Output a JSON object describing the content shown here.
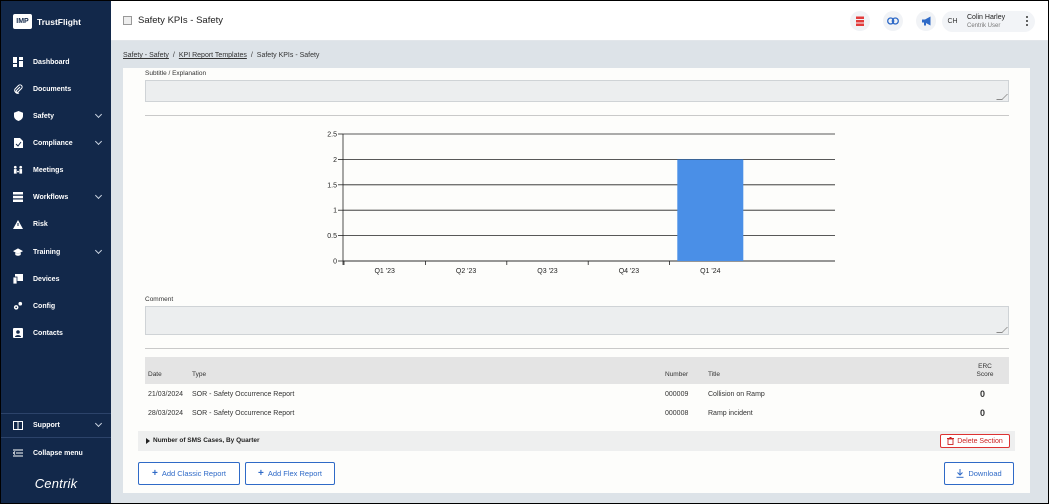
{
  "brand": {
    "logo_text": "IMP",
    "name": "TrustFlight"
  },
  "sidebar": {
    "items": [
      {
        "label": "Dashboard",
        "icon": "dashboard-icon",
        "has_chevron": false
      },
      {
        "label": "Documents",
        "icon": "paperclip-icon",
        "has_chevron": false
      },
      {
        "label": "Safety",
        "icon": "shield-icon",
        "has_chevron": true
      },
      {
        "label": "Compliance",
        "icon": "document-check-icon",
        "has_chevron": true
      },
      {
        "label": "Meetings",
        "icon": "meetings-icon",
        "has_chevron": false
      },
      {
        "label": "Workflows",
        "icon": "workflow-icon",
        "has_chevron": true
      },
      {
        "label": "Risk",
        "icon": "warning-icon",
        "has_chevron": false
      },
      {
        "label": "Training",
        "icon": "graduation-cap-icon",
        "has_chevron": true
      },
      {
        "label": "Devices",
        "icon": "devices-icon",
        "has_chevron": false
      },
      {
        "label": "Config",
        "icon": "config-icon",
        "has_chevron": false
      },
      {
        "label": "Contacts",
        "icon": "contacts-icon",
        "has_chevron": false
      }
    ],
    "support_label": "Support",
    "collapse_label": "Collapse menu",
    "footer_logo": "Centrik"
  },
  "header": {
    "title": "Safety KPIs - Safety",
    "user": {
      "initials": "CH",
      "name": "Colin Harley",
      "role": "Centrik User"
    }
  },
  "breadcrumb": [
    "Safety - Safety",
    "KPI Report Templates",
    "Safety KPIs - Safety"
  ],
  "form": {
    "subtitle_label": "Subtitle / Explanation",
    "subtitle_value": "",
    "comment_label": "Comment",
    "comment_value": ""
  },
  "chart_data": {
    "type": "bar",
    "categories": [
      "Q1 '23",
      "Q2 '23",
      "Q3 '23",
      "Q4 '23",
      "Q1 '24"
    ],
    "values": [
      0,
      0,
      0,
      0,
      2
    ],
    "y_ticks": [
      "0",
      "0.5",
      "1",
      "1.5",
      "2",
      "2.5"
    ],
    "ylim": [
      0,
      2.5
    ],
    "grid": true,
    "bar_color": "#4a8fe7"
  },
  "table": {
    "headers": {
      "date": "Date",
      "type": "Type",
      "number": "Number",
      "title": "Title",
      "erc": "ERC Score"
    },
    "rows": [
      {
        "date": "21/03/2024",
        "type": "SOR - Safety Occurrence Report",
        "number": "000009",
        "title": "Collision on Ramp",
        "erc": "0"
      },
      {
        "date": "28/03/2024",
        "type": "SOR - Safety Occurrence Report",
        "number": "000008",
        "title": "Ramp incident",
        "erc": "0"
      }
    ]
  },
  "section": {
    "title": "Number of SMS Cases, By Quarter",
    "delete_label": "Delete Section"
  },
  "actions": {
    "add_classic": "Add Classic Report",
    "add_flex": "Add Flex Report",
    "download": "Download"
  },
  "colors": {
    "sidebar_bg": "#12284a",
    "accent": "#2f6ac7",
    "danger": "#cc2222"
  }
}
